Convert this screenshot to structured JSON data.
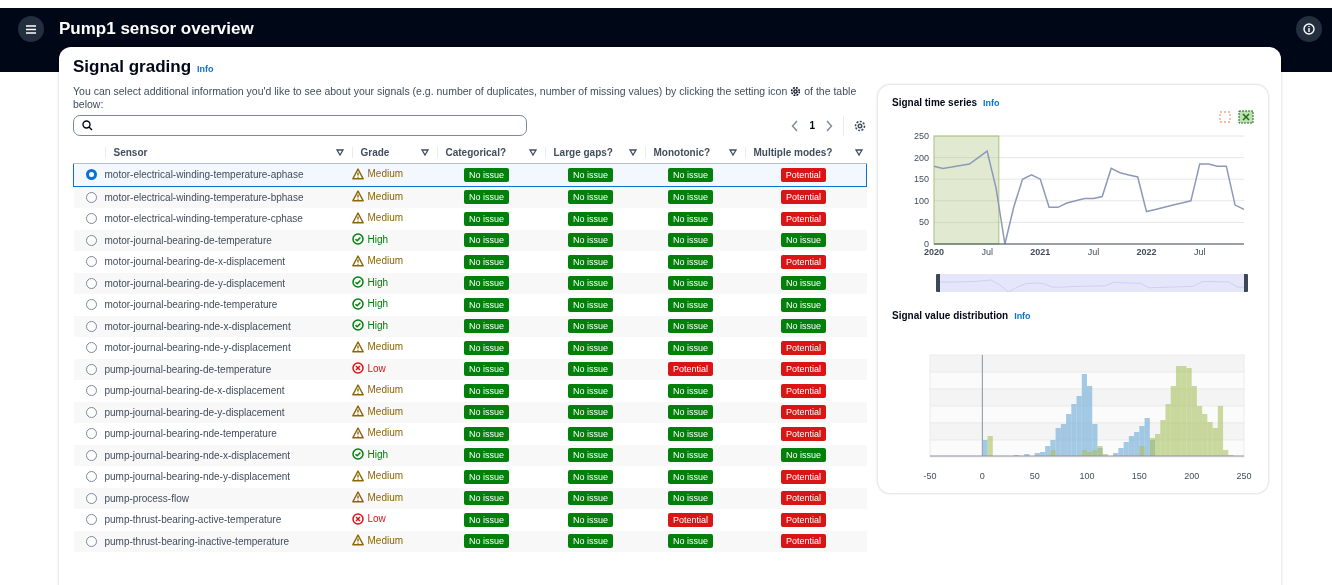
{
  "header": {
    "title": "Pump1 sensor overview"
  },
  "grading": {
    "title": "Signal grading",
    "info": "Info",
    "description_before": "You can select additional information you'd like to see about your signals (e.g. number of duplicates, number of missing values) by clicking the setting icon",
    "description_after": "of the table",
    "description_last": "below:",
    "page": "1",
    "columns": [
      "Sensor",
      "Grade",
      "Categorical?",
      "Large gaps?",
      "Monotonic?",
      "Multiple modes?"
    ],
    "rows": [
      {
        "selected": true,
        "sensor": "motor-electrical-winding-temperature-aphase",
        "grade": {
          "kind": "medium",
          "label": "Medium"
        },
        "checks": [
          {
            "kind": "ok",
            "label": "No issue"
          },
          {
            "kind": "ok",
            "label": "No issue"
          },
          {
            "kind": "ok",
            "label": "No issue"
          },
          {
            "kind": "issue",
            "label": "Potential"
          }
        ]
      },
      {
        "selected": false,
        "sensor": "motor-electrical-winding-temperature-bphase",
        "grade": {
          "kind": "medium",
          "label": "Medium"
        },
        "checks": [
          {
            "kind": "ok",
            "label": "No issue"
          },
          {
            "kind": "ok",
            "label": "No issue"
          },
          {
            "kind": "ok",
            "label": "No issue"
          },
          {
            "kind": "issue",
            "label": "Potential"
          }
        ]
      },
      {
        "selected": false,
        "sensor": "motor-electrical-winding-temperature-cphase",
        "grade": {
          "kind": "medium",
          "label": "Medium"
        },
        "checks": [
          {
            "kind": "ok",
            "label": "No issue"
          },
          {
            "kind": "ok",
            "label": "No issue"
          },
          {
            "kind": "ok",
            "label": "No issue"
          },
          {
            "kind": "issue",
            "label": "Potential"
          }
        ]
      },
      {
        "selected": false,
        "sensor": "motor-journal-bearing-de-temperature",
        "grade": {
          "kind": "high",
          "label": "High"
        },
        "checks": [
          {
            "kind": "ok",
            "label": "No issue"
          },
          {
            "kind": "ok",
            "label": "No issue"
          },
          {
            "kind": "ok",
            "label": "No issue"
          },
          {
            "kind": "ok",
            "label": "No issue"
          }
        ]
      },
      {
        "selected": false,
        "sensor": "motor-journal-bearing-de-x-displacement",
        "grade": {
          "kind": "medium",
          "label": "Medium"
        },
        "checks": [
          {
            "kind": "ok",
            "label": "No issue"
          },
          {
            "kind": "ok",
            "label": "No issue"
          },
          {
            "kind": "ok",
            "label": "No issue"
          },
          {
            "kind": "issue",
            "label": "Potential"
          }
        ]
      },
      {
        "selected": false,
        "sensor": "motor-journal-bearing-de-y-displacement",
        "grade": {
          "kind": "high",
          "label": "High"
        },
        "checks": [
          {
            "kind": "ok",
            "label": "No issue"
          },
          {
            "kind": "ok",
            "label": "No issue"
          },
          {
            "kind": "ok",
            "label": "No issue"
          },
          {
            "kind": "ok",
            "label": "No issue"
          }
        ]
      },
      {
        "selected": false,
        "sensor": "motor-journal-bearing-nde-temperature",
        "grade": {
          "kind": "high",
          "label": "High"
        },
        "checks": [
          {
            "kind": "ok",
            "label": "No issue"
          },
          {
            "kind": "ok",
            "label": "No issue"
          },
          {
            "kind": "ok",
            "label": "No issue"
          },
          {
            "kind": "ok",
            "label": "No issue"
          }
        ]
      },
      {
        "selected": false,
        "sensor": "motor-journal-bearing-nde-x-displacement",
        "grade": {
          "kind": "high",
          "label": "High"
        },
        "checks": [
          {
            "kind": "ok",
            "label": "No issue"
          },
          {
            "kind": "ok",
            "label": "No issue"
          },
          {
            "kind": "ok",
            "label": "No issue"
          },
          {
            "kind": "ok",
            "label": "No issue"
          }
        ]
      },
      {
        "selected": false,
        "sensor": "motor-journal-bearing-nde-y-displacement",
        "grade": {
          "kind": "medium",
          "label": "Medium"
        },
        "checks": [
          {
            "kind": "ok",
            "label": "No issue"
          },
          {
            "kind": "ok",
            "label": "No issue"
          },
          {
            "kind": "ok",
            "label": "No issue"
          },
          {
            "kind": "issue",
            "label": "Potential"
          }
        ]
      },
      {
        "selected": false,
        "sensor": "pump-journal-bearing-de-temperature",
        "grade": {
          "kind": "low",
          "label": "Low"
        },
        "checks": [
          {
            "kind": "ok",
            "label": "No issue"
          },
          {
            "kind": "ok",
            "label": "No issue"
          },
          {
            "kind": "issue",
            "label": "Potential"
          },
          {
            "kind": "issue",
            "label": "Potential"
          }
        ]
      },
      {
        "selected": false,
        "sensor": "pump-journal-bearing-de-x-displacement",
        "grade": {
          "kind": "medium",
          "label": "Medium"
        },
        "checks": [
          {
            "kind": "ok",
            "label": "No issue"
          },
          {
            "kind": "ok",
            "label": "No issue"
          },
          {
            "kind": "ok",
            "label": "No issue"
          },
          {
            "kind": "issue",
            "label": "Potential"
          }
        ]
      },
      {
        "selected": false,
        "sensor": "pump-journal-bearing-de-y-displacement",
        "grade": {
          "kind": "medium",
          "label": "Medium"
        },
        "checks": [
          {
            "kind": "ok",
            "label": "No issue"
          },
          {
            "kind": "ok",
            "label": "No issue"
          },
          {
            "kind": "ok",
            "label": "No issue"
          },
          {
            "kind": "issue",
            "label": "Potential"
          }
        ]
      },
      {
        "selected": false,
        "sensor": "pump-journal-bearing-nde-temperature",
        "grade": {
          "kind": "medium",
          "label": "Medium"
        },
        "checks": [
          {
            "kind": "ok",
            "label": "No issue"
          },
          {
            "kind": "ok",
            "label": "No issue"
          },
          {
            "kind": "ok",
            "label": "No issue"
          },
          {
            "kind": "issue",
            "label": "Potential"
          }
        ]
      },
      {
        "selected": false,
        "sensor": "pump-journal-bearing-nde-x-displacement",
        "grade": {
          "kind": "high",
          "label": "High"
        },
        "checks": [
          {
            "kind": "ok",
            "label": "No issue"
          },
          {
            "kind": "ok",
            "label": "No issue"
          },
          {
            "kind": "ok",
            "label": "No issue"
          },
          {
            "kind": "ok",
            "label": "No issue"
          }
        ]
      },
      {
        "selected": false,
        "sensor": "pump-journal-bearing-nde-y-displacement",
        "grade": {
          "kind": "medium",
          "label": "Medium"
        },
        "checks": [
          {
            "kind": "ok",
            "label": "No issue"
          },
          {
            "kind": "ok",
            "label": "No issue"
          },
          {
            "kind": "ok",
            "label": "No issue"
          },
          {
            "kind": "issue",
            "label": "Potential"
          }
        ]
      },
      {
        "selected": false,
        "sensor": "pump-process-flow",
        "grade": {
          "kind": "medium",
          "label": "Medium"
        },
        "checks": [
          {
            "kind": "ok",
            "label": "No issue"
          },
          {
            "kind": "ok",
            "label": "No issue"
          },
          {
            "kind": "ok",
            "label": "No issue"
          },
          {
            "kind": "issue",
            "label": "Potential"
          }
        ]
      },
      {
        "selected": false,
        "sensor": "pump-thrust-bearing-active-temperature",
        "grade": {
          "kind": "low",
          "label": "Low"
        },
        "checks": [
          {
            "kind": "ok",
            "label": "No issue"
          },
          {
            "kind": "ok",
            "label": "No issue"
          },
          {
            "kind": "issue",
            "label": "Potential"
          },
          {
            "kind": "issue",
            "label": "Potential"
          }
        ]
      },
      {
        "selected": false,
        "sensor": "pump-thrust-bearing-inactive-temperature",
        "grade": {
          "kind": "medium",
          "label": "Medium"
        },
        "checks": [
          {
            "kind": "ok",
            "label": "No issue"
          },
          {
            "kind": "ok",
            "label": "No issue"
          },
          {
            "kind": "ok",
            "label": "No issue"
          },
          {
            "kind": "issue",
            "label": "Potential"
          }
        ]
      }
    ]
  },
  "time_series": {
    "title": "Signal time series",
    "info": "Info",
    "chart_data": {
      "type": "line",
      "x": [
        2020.0,
        2020.083,
        2020.167,
        2020.25,
        2020.333,
        2020.417,
        2020.5,
        2020.583,
        2020.667,
        2020.75,
        2020.833,
        2020.917,
        2021.0,
        2021.083,
        2021.167,
        2021.25,
        2021.333,
        2021.417,
        2021.5,
        2021.583,
        2021.667,
        2021.75,
        2021.833,
        2021.917,
        2022.0,
        2022.083,
        2022.167,
        2022.25,
        2022.333,
        2022.417,
        2022.5,
        2022.583,
        2022.667,
        2022.75,
        2022.833,
        2022.917
      ],
      "series": [
        {
          "color": "#8d99ba",
          "values": [
            180,
            175,
            178,
            182,
            185,
            200,
            215,
            130,
            0,
            85,
            150,
            160,
            150,
            85,
            85,
            95,
            100,
            105,
            105,
            110,
            175,
            165,
            160,
            155,
            75,
            80,
            85,
            90,
            95,
            100,
            185,
            185,
            180,
            180,
            90,
            80
          ]
        }
      ],
      "grid": true,
      "bands": [
        {
          "axis": "x",
          "from": 2020,
          "to": 2020.61,
          "color": "#a8c27a"
        }
      ],
      "xlim": [
        2020,
        2022.917
      ],
      "ylim": [
        0,
        250
      ],
      "yticks": [
        0,
        50,
        100,
        150,
        200,
        250
      ],
      "xticks": [
        {
          "value": 2020,
          "label": "2020"
        },
        {
          "value": 2020.5,
          "label": "Jul"
        },
        {
          "value": 2021,
          "label": "2021"
        },
        {
          "value": 2021.5,
          "label": "Jul"
        },
        {
          "value": 2022,
          "label": "2022"
        },
        {
          "value": 2022.5,
          "label": "Jul"
        }
      ]
    }
  },
  "distribution": {
    "title": "Signal value distribution",
    "info": "Info",
    "axis_labels": [
      "-50",
      "0",
      "50",
      "100",
      "150",
      "200",
      "250"
    ]
  }
}
